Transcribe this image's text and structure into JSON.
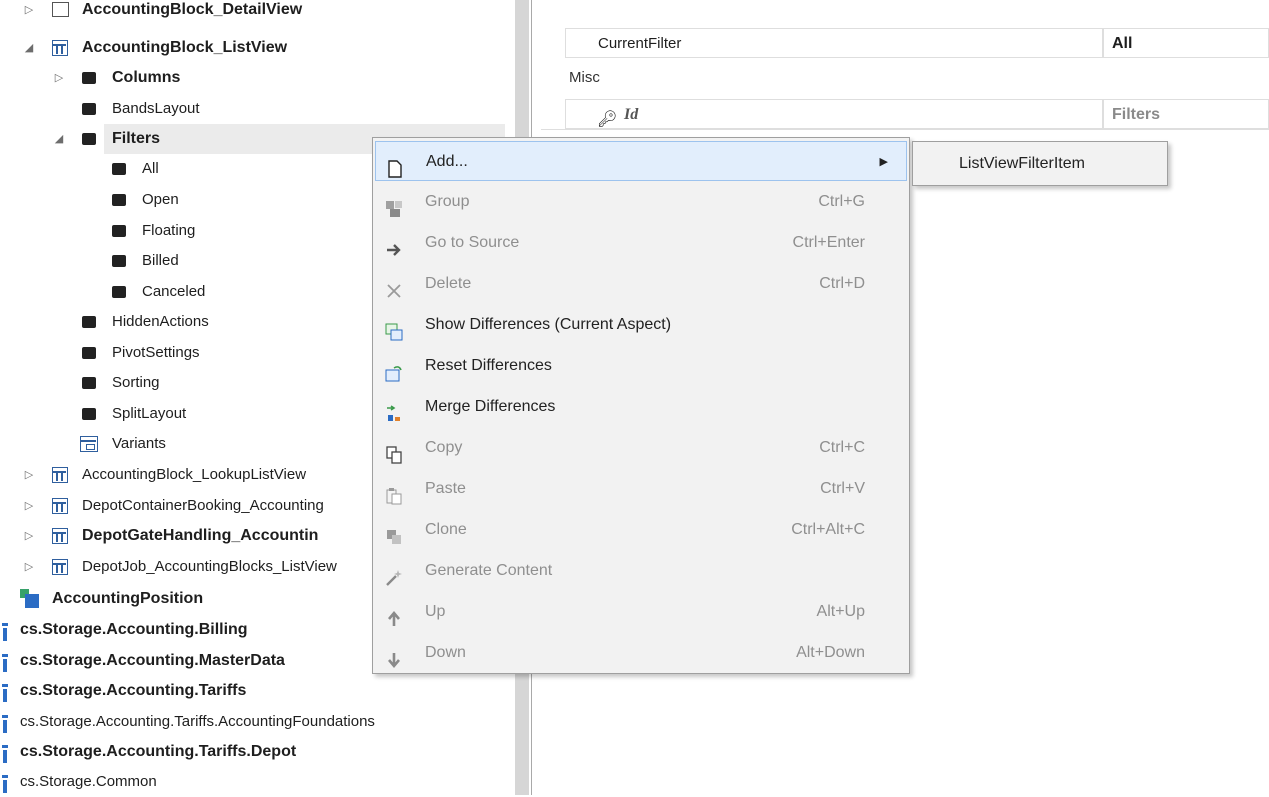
{
  "tree": {
    "items": [
      {
        "label": "AccountingBlock_DetailView",
        "bold": true,
        "expander": "▷",
        "icon": "detail-view-icon"
      },
      {
        "label": "AccountingBlock_ListView",
        "bold": true,
        "expander": "◢",
        "icon": "list-view-icon"
      },
      {
        "label": "Columns",
        "bold": true,
        "expander": "▷",
        "icon": "node-icon"
      },
      {
        "label": "BandsLayout",
        "icon": "node-icon"
      },
      {
        "label": "Filters",
        "bold": true,
        "expander": "◢",
        "icon": "node-icon",
        "selected": true
      },
      {
        "label": "All",
        "icon": "node-icon"
      },
      {
        "label": "Open",
        "icon": "node-icon"
      },
      {
        "label": "Floating",
        "icon": "node-icon"
      },
      {
        "label": "Billed",
        "icon": "node-icon"
      },
      {
        "label": "Canceled",
        "icon": "node-icon"
      },
      {
        "label": "HiddenActions",
        "icon": "node-icon"
      },
      {
        "label": "PivotSettings",
        "icon": "node-icon"
      },
      {
        "label": "Sorting",
        "icon": "node-icon"
      },
      {
        "label": "SplitLayout",
        "icon": "node-icon"
      },
      {
        "label": "Variants",
        "icon": "variants-icon"
      },
      {
        "label": "AccountingBlock_LookupListView",
        "expander": "▷",
        "icon": "list-view-icon"
      },
      {
        "label": "DepotContainerBooking_Accounting",
        "expander": "▷",
        "icon": "list-view-icon"
      },
      {
        "label": "DepotGateHandling_Accountin",
        "bold": true,
        "expander": "▷",
        "icon": "list-view-icon"
      },
      {
        "label": "DepotJob_AccountingBlocks_ListView",
        "expander": "▷",
        "icon": "list-view-icon"
      },
      {
        "label": "AccountingPosition",
        "bold": true,
        "icon": "class-icon"
      },
      {
        "label": "cs.Storage.Accounting.Billing",
        "bold": true,
        "icon": "namespace-icon"
      },
      {
        "label": "cs.Storage.Accounting.MasterData",
        "bold": true,
        "icon": "namespace-icon"
      },
      {
        "label": "cs.Storage.Accounting.Tariffs",
        "bold": true,
        "icon": "namespace-icon"
      },
      {
        "label": "cs.Storage.Accounting.Tariffs.AccountingFoundations",
        "icon": "namespace-icon"
      },
      {
        "label": "cs.Storage.Accounting.Tariffs.Depot",
        "bold": true,
        "icon": "namespace-icon"
      },
      {
        "label": "cs.Storage.Common",
        "icon": "namespace-icon"
      }
    ]
  },
  "properties": {
    "current_filter": {
      "name": "CurrentFilter",
      "value": "All"
    },
    "category": "Misc",
    "id": {
      "name": "Id",
      "value": "Filters"
    }
  },
  "context_menu": {
    "items": [
      {
        "label": "Add...",
        "shortcut": "",
        "icon": "new-document-icon",
        "enabled": true,
        "submenu": true
      },
      {
        "label": "Group",
        "shortcut": "Ctrl+G",
        "icon": "group-icon",
        "enabled": false
      },
      {
        "label": "Go to Source",
        "shortcut": "Ctrl+Enter",
        "icon": "arrow-right-icon",
        "enabled": false
      },
      {
        "label": "Delete",
        "shortcut": "Ctrl+D",
        "icon": "close-icon",
        "enabled": false
      },
      {
        "label": "Show Differences (Current Aspect)",
        "shortcut": "",
        "icon": "xml-diff-icon",
        "enabled": true
      },
      {
        "label": "Reset Differences",
        "shortcut": "",
        "icon": "xml-reset-icon",
        "enabled": true
      },
      {
        "label": "Merge Differences",
        "shortcut": "",
        "icon": "merge-icon",
        "enabled": true
      },
      {
        "label": "Copy",
        "shortcut": "Ctrl+C",
        "icon": "copy-icon",
        "enabled": false
      },
      {
        "label": "Paste",
        "shortcut": "Ctrl+V",
        "icon": "paste-icon",
        "enabled": false
      },
      {
        "label": "Clone",
        "shortcut": "Ctrl+Alt+C",
        "icon": "clone-icon",
        "enabled": false
      },
      {
        "label": "Generate Content",
        "shortcut": "",
        "icon": "magic-wand-icon",
        "enabled": false
      },
      {
        "label": "Up",
        "shortcut": "Alt+Up",
        "icon": "arrow-up-icon",
        "enabled": false
      },
      {
        "label": "Down",
        "shortcut": "Alt+Down",
        "icon": "arrow-down-icon",
        "enabled": false
      }
    ],
    "submenu_items": [
      "ListViewFilterItem"
    ]
  },
  "colors": {
    "highlight": "#e2eefc",
    "accent_blue": "#2b6cc4",
    "menu_bg": "#f2f2f2"
  }
}
